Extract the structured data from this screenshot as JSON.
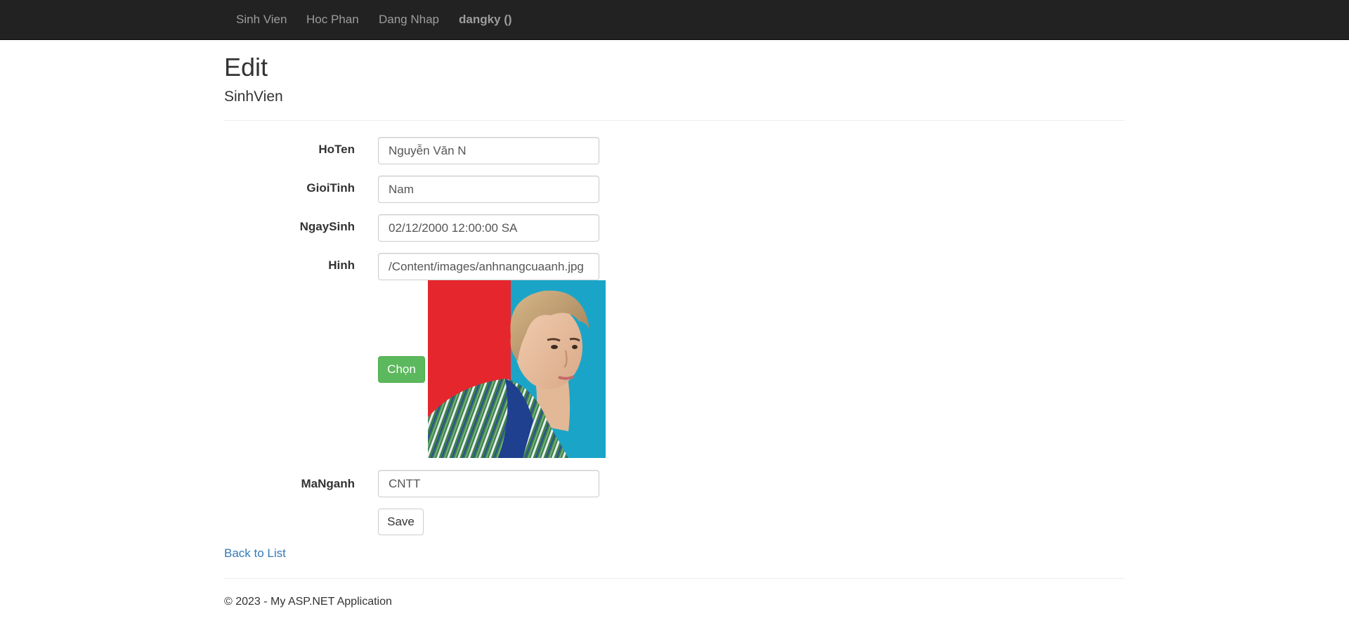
{
  "navbar": {
    "items": [
      {
        "label": "Sinh Vien"
      },
      {
        "label": "Hoc Phan"
      },
      {
        "label": "Dang Nhap"
      },
      {
        "label": "dangky ()"
      }
    ]
  },
  "header": {
    "title": "Edit",
    "subtitle": "SinhVien"
  },
  "form": {
    "hoten": {
      "label": "HoTen",
      "value": "Nguyễn Văn N"
    },
    "gioitinh": {
      "label": "GioiTinh",
      "value": "Nam"
    },
    "ngaysinh": {
      "label": "NgaySinh",
      "value": "02/12/2000 12:00:00 SA"
    },
    "hinh": {
      "label": "Hinh",
      "value": "/Content/images/anhnangcuaanh.jpg"
    },
    "choose_button": "Chọn",
    "manganh": {
      "label": "MaNganh",
      "value": "CNTT"
    },
    "save_button": "Save"
  },
  "links": {
    "back_to_list": "Back to List"
  },
  "footer": {
    "text": "© 2023 - My ASP.NET Application"
  },
  "colors": {
    "navbar_bg": "#222222",
    "nav_text": "#9d9d9d",
    "success": "#5cb85c",
    "link": "#337ab7"
  }
}
